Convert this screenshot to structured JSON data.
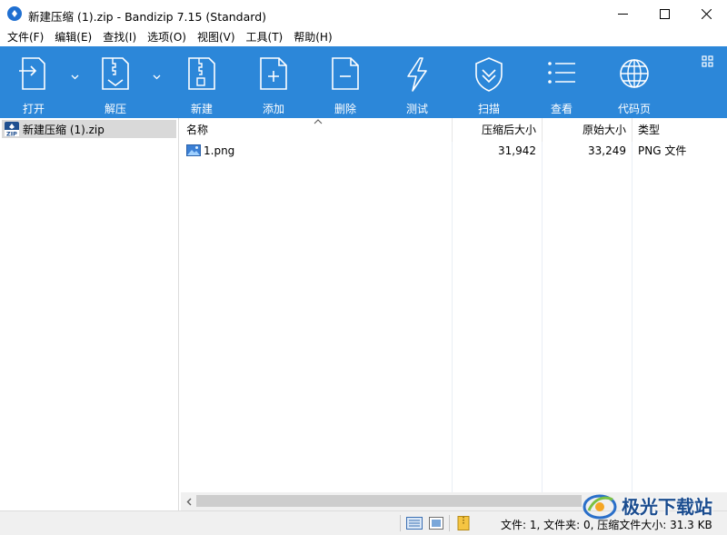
{
  "window": {
    "title": "新建压缩 (1).zip - Bandizip 7.15 (Standard)"
  },
  "menu": {
    "items": [
      "文件(F)",
      "编辑(E)",
      "查找(I)",
      "选项(O)",
      "视图(V)",
      "工具(T)",
      "帮助(H)"
    ]
  },
  "toolbar": {
    "open": "打开",
    "extract": "解压",
    "new": "新建",
    "add": "添加",
    "delete": "删除",
    "test": "测试",
    "scan": "扫描",
    "view": "查看",
    "codepage": "代码页"
  },
  "tree": {
    "root": "新建压缩 (1).zip"
  },
  "list": {
    "columns": {
      "name": "名称",
      "compressed": "压缩后大小",
      "original": "原始大小",
      "type": "类型"
    },
    "rows": [
      {
        "name": "1.png",
        "compressed": "31,942",
        "original": "33,249",
        "type": "PNG 文件"
      }
    ]
  },
  "status": {
    "text": "文件: 1, 文件夹: 0, 压缩文件大小: 31.3 KB"
  },
  "watermark": {
    "text": "极光下载站"
  },
  "colors": {
    "toolbar": "#2c87d9",
    "selection": "#d9d9d9"
  }
}
